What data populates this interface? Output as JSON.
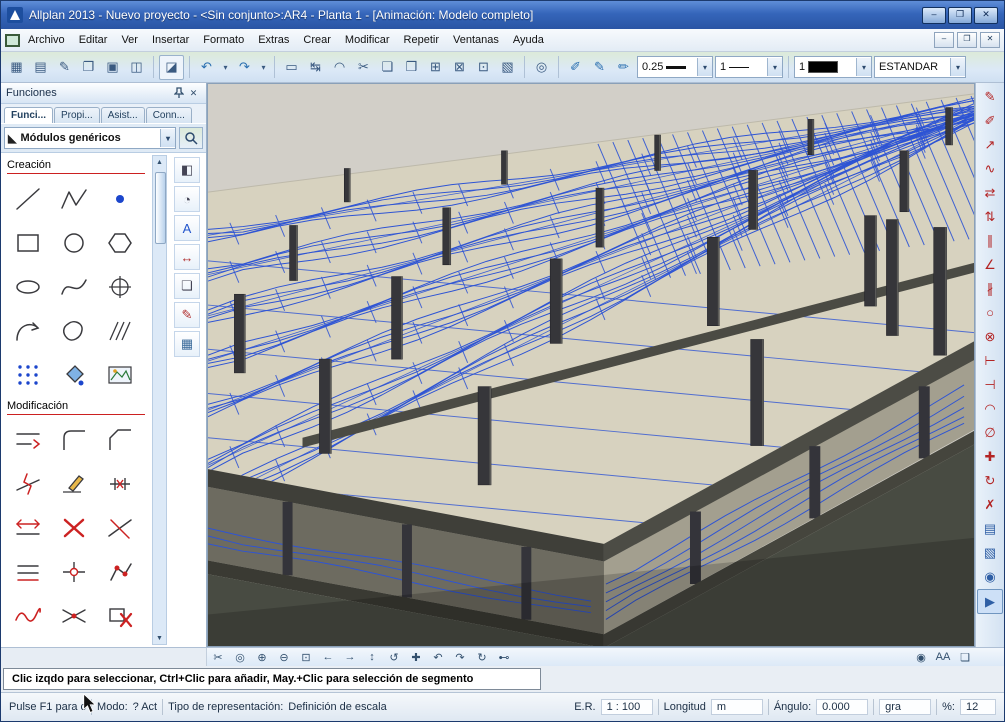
{
  "window": {
    "title": "Allplan 2013 - Nuevo proyecto - <Sin conjunto>:AR4 - Planta 1 - [Animación: Modelo completo]"
  },
  "titlebar_buttons": {
    "minimize": "–",
    "restore": "❐",
    "close": "✕"
  },
  "menu": {
    "items": [
      "Archivo",
      "Editar",
      "Ver",
      "Insertar",
      "Formato",
      "Extras",
      "Crear",
      "Modificar",
      "Repetir",
      "Ventanas",
      "Ayuda"
    ]
  },
  "toolbar": {
    "file_tools": [
      {
        "name": "project-open-icon",
        "glyph": "▦"
      },
      {
        "name": "document-pool-icon",
        "glyph": "▤"
      },
      {
        "name": "document-edit-icon",
        "glyph": "✎"
      },
      {
        "name": "open-folder-icon",
        "glyph": "❐"
      },
      {
        "name": "save-icon",
        "glyph": "▣"
      },
      {
        "name": "print-icon",
        "glyph": "◫"
      }
    ],
    "assistant_tool": {
      "name": "assistant-icon",
      "glyph": "◪"
    },
    "undo": {
      "name": "undo-icon",
      "glyph": "↶"
    },
    "redo": {
      "name": "redo-icon",
      "glyph": "↷"
    },
    "draw_tools": [
      {
        "name": "ruler-icon",
        "glyph": "▭"
      },
      {
        "name": "dimension-icon",
        "glyph": "↹"
      },
      {
        "name": "protractor-icon",
        "glyph": "◠"
      },
      {
        "name": "scissors-icon",
        "glyph": "✂"
      },
      {
        "name": "copy-view-icon",
        "glyph": "❏"
      },
      {
        "name": "paste-view-icon",
        "glyph": "❒"
      },
      {
        "name": "grid-icon",
        "glyph": "⊞"
      },
      {
        "name": "crossing-icon",
        "glyph": "⊠"
      },
      {
        "name": "region-select-icon",
        "glyph": "⊡"
      },
      {
        "name": "cube-3d-icon",
        "glyph": "▧"
      }
    ],
    "zoom_tool": {
      "name": "zoom-icon",
      "glyph": "◎"
    },
    "pen_tools": [
      {
        "name": "eyedropper-icon",
        "glyph": "✐",
        "color": "#2a6fb0"
      },
      {
        "name": "pen-icon",
        "glyph": "✎",
        "color": "#2a6fb0"
      },
      {
        "name": "brush-icon",
        "glyph": "✏",
        "color": "#2a6fb0"
      }
    ],
    "pen_thickness": "0.25",
    "line_type": "1",
    "color_number": "1",
    "layer": "ESTANDAR"
  },
  "panel": {
    "title": "Funciones",
    "tabs": [
      "Funci...",
      "Propi...",
      "Asist...",
      "Conn..."
    ],
    "active_tab": 0,
    "module_selector": "Módulos genéricos",
    "strip_tools": [
      {
        "name": "palette-icon",
        "glyph": "◧"
      },
      {
        "name": "protractor-icon",
        "glyph": "◔"
      },
      {
        "name": "text-icon",
        "glyph": "A",
        "color": "#2255cc"
      },
      {
        "name": "dimension-icon",
        "glyph": "↔",
        "color": "#b03030"
      },
      {
        "name": "plan-icon",
        "glyph": "❏"
      },
      {
        "name": "pen-icon",
        "glyph": "✎",
        "color": "#b03030"
      },
      {
        "name": "table-icon",
        "glyph": "▦",
        "color": "#3a6a9a"
      }
    ],
    "sections": [
      {
        "title": "Creación",
        "tools": [
          "line",
          "polyline",
          "point",
          "rectangle",
          "circle",
          "polygon",
          "ellipse",
          "spline",
          "circle-center",
          "arc-arrow",
          "freeform-area",
          "hatching",
          "point-grid",
          "fill-area",
          "image-area"
        ]
      },
      {
        "title": "Modificación",
        "tools": [
          "offset",
          "fillet",
          "chamfer",
          "break-element",
          "edit-pencil",
          "delete-segment",
          "stretch",
          "delete",
          "cross-element",
          "parallel-copy",
          "node-edit",
          "move-points",
          "adjust-curve",
          "intersect",
          "delete-element"
        ]
      }
    ]
  },
  "right_toolbar": {
    "tools": [
      {
        "name": "reinforce-pen-icon",
        "glyph": "✎",
        "color": "#b32424"
      },
      {
        "name": "freehand-icon",
        "glyph": "✐",
        "color": "#b32424"
      },
      {
        "name": "leader-line-icon",
        "glyph": "↗",
        "color": "#b32424"
      },
      {
        "name": "spline-bar-icon",
        "glyph": "∿",
        "color": "#b32424"
      },
      {
        "name": "mirror-h-icon",
        "glyph": "⇄",
        "color": "#b32424"
      },
      {
        "name": "mirror-v-icon",
        "glyph": "⇅",
        "color": "#b32424"
      },
      {
        "name": "parallel-icon",
        "glyph": "∥",
        "color": "#b32424"
      },
      {
        "name": "angle-icon",
        "glyph": "∠",
        "color": "#b32424"
      },
      {
        "name": "divide-icon",
        "glyph": "∦",
        "color": "#b32424"
      },
      {
        "name": "circle-bar-icon",
        "glyph": "○",
        "color": "#b32424"
      },
      {
        "name": "intersect-icon",
        "glyph": "⊗",
        "color": "#b32424"
      },
      {
        "name": "trim-icon",
        "glyph": "⊢",
        "color": "#b32424"
      },
      {
        "name": "extend-icon",
        "glyph": "⊣",
        "color": "#b32424"
      },
      {
        "name": "fillet-icon",
        "glyph": "◠",
        "color": "#b32424"
      },
      {
        "name": "measure-icon",
        "glyph": "∅",
        "color": "#b32424"
      },
      {
        "name": "move-icon",
        "glyph": "✚",
        "color": "#b32424"
      },
      {
        "name": "rotate-icon",
        "glyph": "↻",
        "color": "#b32424"
      },
      {
        "name": "delete-icon",
        "glyph": "✗",
        "color": "#b32424"
      },
      {
        "name": "list-icon",
        "glyph": "▤",
        "color": "#2f5fa5"
      },
      {
        "name": "layers-icon",
        "glyph": "▧",
        "color": "#2f5fa5"
      },
      {
        "name": "camera-icon",
        "glyph": "◉",
        "color": "#2f5fa5"
      },
      {
        "name": "animation-icon",
        "glyph": "▶",
        "color": "#2f5fa5",
        "pressed": true
      }
    ]
  },
  "viewport": {
    "hint": "Clic izqdo para seleccionar, Ctrl+Clic para añadir, May.+Clic para selección de segmento",
    "bottom_tools": [
      {
        "name": "clip-icon",
        "glyph": "✂"
      },
      {
        "name": "zoom-all-icon",
        "glyph": "◎"
      },
      {
        "name": "zoom-in-icon",
        "glyph": "⊕"
      },
      {
        "name": "zoom-out-icon",
        "glyph": "⊖"
      },
      {
        "name": "zoom-window-icon",
        "glyph": "⊡"
      },
      {
        "name": "pan-left-icon",
        "glyph": "←"
      },
      {
        "name": "pan-right-icon",
        "glyph": "→"
      },
      {
        "name": "pan-vertical-icon",
        "glyph": "↕"
      },
      {
        "name": "rotate-view-icon",
        "glyph": "↺"
      },
      {
        "name": "move-view-icon",
        "glyph": "✚"
      },
      {
        "name": "previous-view-icon",
        "glyph": "↶"
      },
      {
        "name": "next-view-icon",
        "glyph": "↷"
      },
      {
        "name": "refresh-view-icon",
        "glyph": "↻"
      },
      {
        "name": "link-view-icon",
        "glyph": "⊷"
      }
    ],
    "bottom_tools_right": [
      {
        "name": "camera-icon",
        "glyph": "◉"
      },
      {
        "name": "antialias-icon",
        "glyph": "AA"
      },
      {
        "name": "sheet-icon",
        "glyph": "❏"
      }
    ],
    "colors": {
      "slab": "#d7d2bf",
      "rebar": "#2e54d4",
      "column": "#36363a",
      "background": "#d2cfc8"
    }
  },
  "statusbar": {
    "help": "Pulse F1 para c",
    "mode_label": "Modo:",
    "mode_value": "? Act",
    "repr_label": "Tipo de representación:",
    "repr_value": "Definición de escala",
    "scale_label": "E.R.",
    "scale_value": "1 : 100",
    "length_label": "Longitud",
    "length_unit": "m",
    "angle_label": "Ángulo:",
    "angle_value": "0.000",
    "angle_unit": "gra",
    "percent_label": "%:",
    "percent_value": "12"
  }
}
